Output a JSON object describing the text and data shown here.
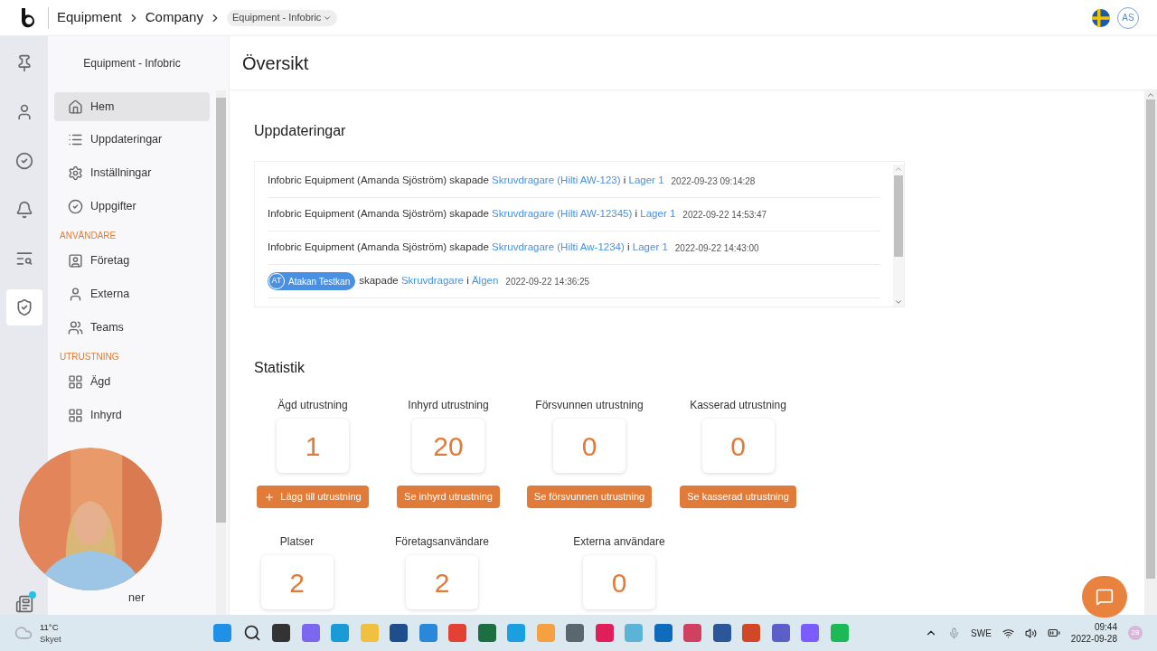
{
  "header": {
    "breadcrumbs": [
      "Equipment",
      "Company"
    ],
    "workspace": "Equipment - Infobric",
    "avatar": "AS"
  },
  "rail": [
    {
      "selected": false
    },
    {
      "selected": false
    },
    {
      "selected": false
    },
    {
      "selected": false
    },
    {
      "selected": false
    },
    {
      "selected": true
    },
    {
      "selected": false
    }
  ],
  "sidebar": {
    "title": "Equipment - Infobric",
    "sections": [
      {
        "items": [
          {
            "label": "Hem",
            "selected": true
          },
          {
            "label": "Uppdateringar",
            "selected": false
          },
          {
            "label": "Inställningar",
            "selected": false
          },
          {
            "label": "Uppgifter",
            "selected": false
          }
        ]
      },
      {
        "heading": "ANVÄNDARE",
        "items": [
          {
            "label": "Företag",
            "selected": false
          },
          {
            "label": "Externa",
            "selected": false
          },
          {
            "label": "Teams",
            "selected": false
          }
        ]
      },
      {
        "heading": "UTRUSTNING",
        "items": [
          {
            "label": "Ägd",
            "selected": false
          },
          {
            "label": "Inhyrd",
            "selected": false
          }
        ]
      }
    ],
    "hidden_item": "ner"
  },
  "page_title": "Översikt",
  "updates": {
    "title": "Uppdateringar",
    "entries": [
      {
        "kind": "text",
        "actor": "Infobric Equipment (Amanda Sjöström)",
        "verb": "skapade",
        "item": "Skruvdragare (Hilti AW-123)",
        "sep": "i",
        "location": "Lager 1",
        "time": "2022-09-23 09:14:28"
      },
      {
        "kind": "text",
        "actor": "Infobric Equipment (Amanda Sjöström)",
        "verb": "skapade",
        "item": "Skruvdragare (Hilti AW-12345)",
        "sep": "i",
        "location": "Lager 1",
        "time": "2022-09-22 14:53:47"
      },
      {
        "kind": "text",
        "actor": "Infobric Equipment (Amanda Sjöström)",
        "verb": "skapade",
        "item": "Skruvdragare (Hilti Aw-1234)",
        "sep": "i",
        "location": "Lager 1",
        "time": "2022-09-22 14:43:00"
      },
      {
        "kind": "badge",
        "initials": "AT",
        "actor": "Atakan Testkan",
        "verb": "skapade",
        "item": "Skruvdragare",
        "sep": "i",
        "location": "Älgen",
        "time": "2022-09-22 14:36:25"
      }
    ]
  },
  "statistics": {
    "title": "Statistik",
    "row1": [
      {
        "label": "Ägd utrustning",
        "value": "1",
        "button": "Lägg till utrustning",
        "kind": "add"
      },
      {
        "label": "Inhyrd utrustning",
        "value": "20",
        "button": "Se inhyrd utrustning",
        "kind": "plain"
      },
      {
        "label": "Försvunnen utrustning",
        "value": "0",
        "button": "Se försvunnen utrustning",
        "kind": "plain"
      },
      {
        "label": "Kasserad utrustning",
        "value": "0",
        "button": "Se kasserad utrustning",
        "kind": "plain"
      }
    ],
    "row2": [
      {
        "label": "Platser",
        "value": "2"
      },
      {
        "label": "Företagsanvändare",
        "value": "2"
      },
      {
        "label": "Externa användare",
        "value": "0"
      }
    ]
  },
  "taskbar": {
    "temperature": "11°C",
    "weather": "Skyet",
    "language": "SWE",
    "time": "09:44",
    "date": "2022-09-28",
    "notifications": "28"
  }
}
